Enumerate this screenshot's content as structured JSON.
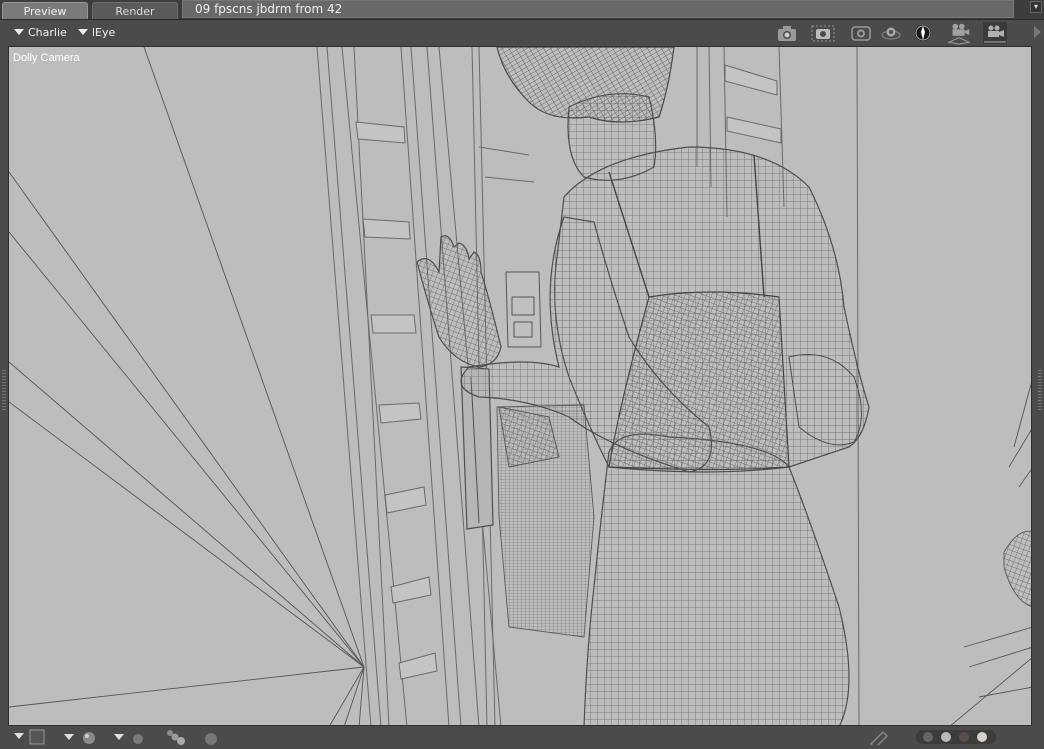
{
  "tabs": {
    "preview": "Preview",
    "render": "Render"
  },
  "scene_title": "09 fpscns jbdrm from 42",
  "toolbar": {
    "figure_select": "Charlie",
    "camera_select": "lEye",
    "camera_icons": [
      "snapshot-camera-icon",
      "render-camera-icon",
      "camera-lens-icon",
      "orbit-sphere-icon",
      "shaded-sphere-icon",
      "projector-camera-icon",
      "video-camera-icon"
    ]
  },
  "viewport": {
    "label": "Dolly Camera",
    "background": "#bdbdbd"
  },
  "bottom_bar": {
    "icons": [
      "viewport-layout-icon",
      "sphere-light-icon",
      "sphere-shade-icon",
      "multi-sphere-icon",
      "sphere-dark-icon",
      "ruler-icon",
      "render-preview-dots-icon"
    ]
  }
}
